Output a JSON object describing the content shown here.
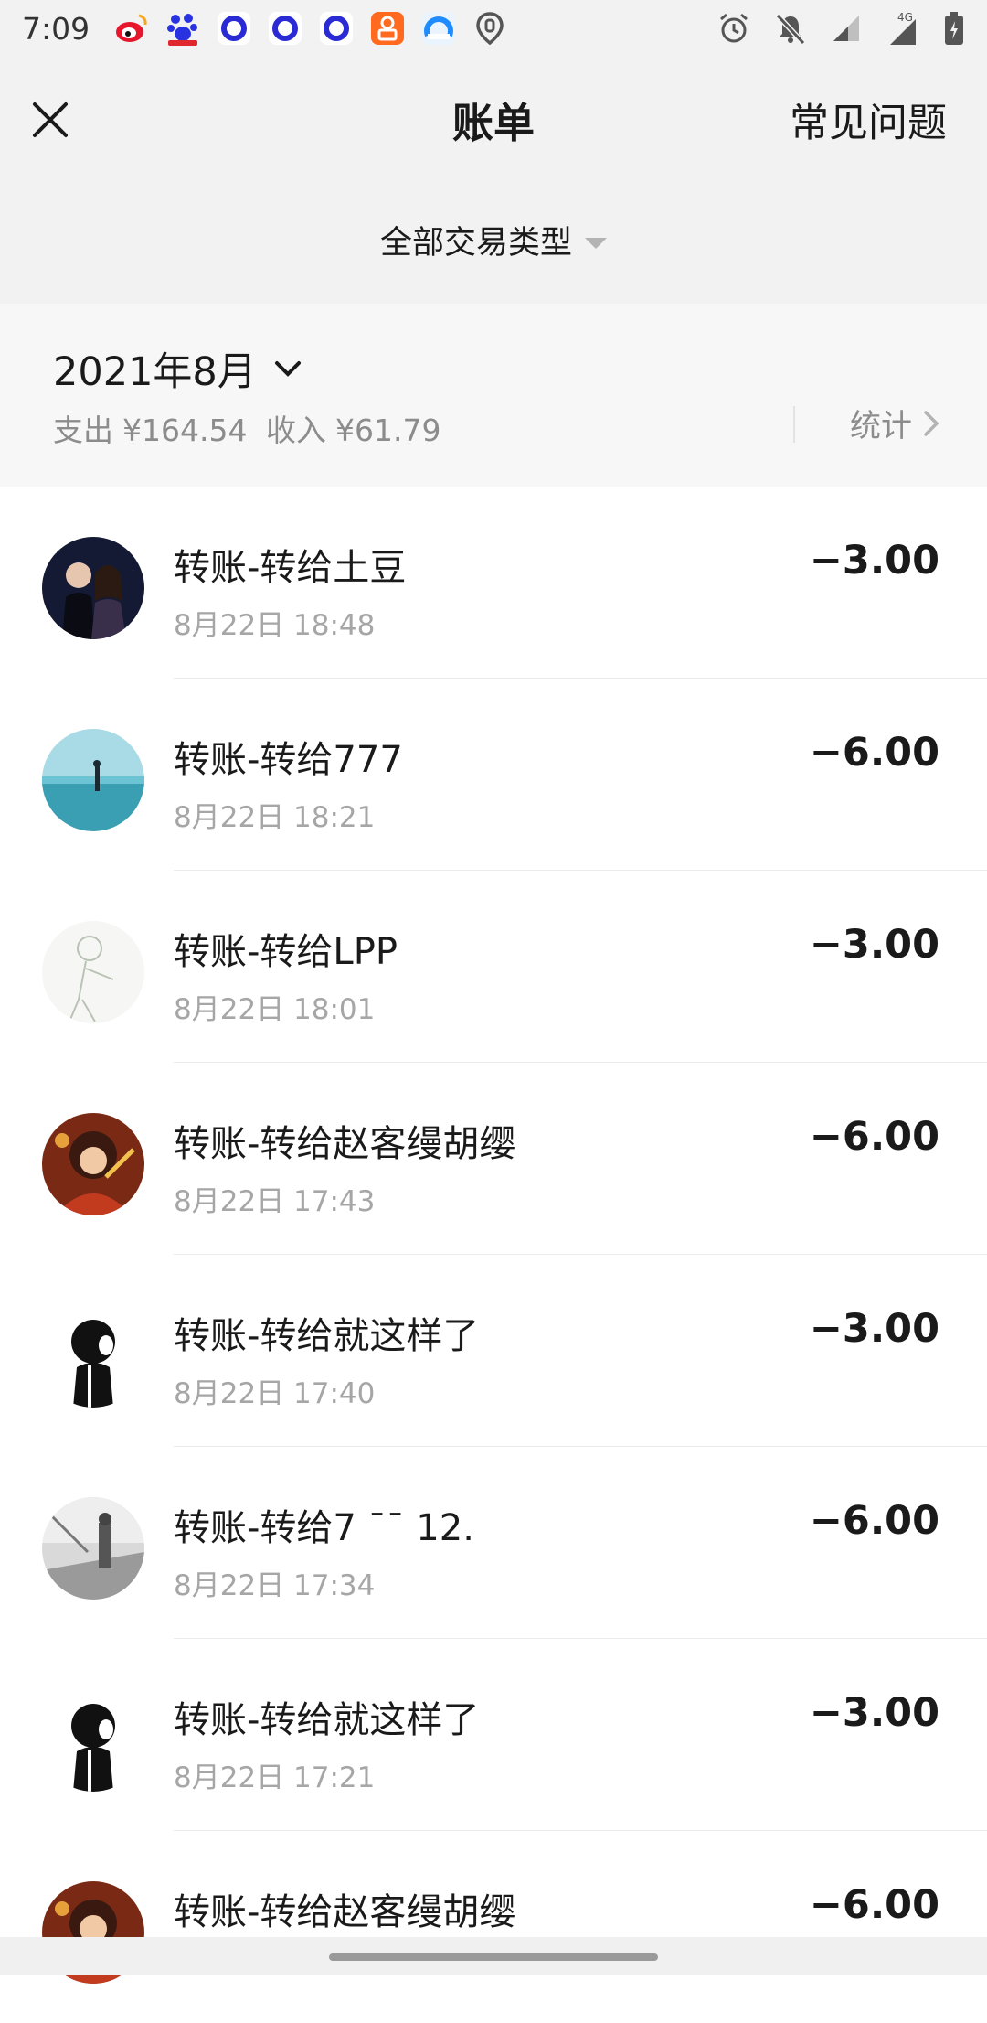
{
  "status_bar": {
    "time": "7:09",
    "apps": [
      "weibo-icon",
      "baidu-icon",
      "app-circle-icon",
      "app-circle-icon",
      "app-circle-icon",
      "taobao-icon",
      "browser-icon",
      "location-icon"
    ],
    "network": "4G"
  },
  "nav": {
    "title": "账单",
    "faq_label": "常见问题"
  },
  "filter": {
    "label": "全部交易类型"
  },
  "month": {
    "label": "2021年8月",
    "expense_label": "支出",
    "expense_value": "¥164.54",
    "income_label": "收入",
    "income_value": "¥61.79",
    "stats_label": "统计"
  },
  "transactions": [
    {
      "title": "转账-转给土豆",
      "time": "8月22日 18:48",
      "amount": "−3.00"
    },
    {
      "title": "转账-转给777",
      "time": "8月22日 18:21",
      "amount": "−6.00"
    },
    {
      "title": "转账-转给LPP",
      "time": "8月22日 18:01",
      "amount": "−3.00"
    },
    {
      "title": "转账-转给赵客缦胡缨",
      "time": "8月22日 17:43",
      "amount": "−6.00"
    },
    {
      "title": "转账-转给就这样了",
      "time": "8月22日 17:40",
      "amount": "−3.00"
    },
    {
      "title": "转账-转给7 ¯¯ 12.",
      "time": "8月22日 17:34",
      "amount": "−6.00"
    },
    {
      "title": "转账-转给就这样了",
      "time": "8月22日 17:21",
      "amount": "−3.00"
    },
    {
      "title": "转账-转给赵客缦胡缨",
      "time": "",
      "amount": "−6.00"
    }
  ],
  "colors": {
    "header_bg": "#f2f2f2",
    "summary_bg": "#f7f7f7",
    "secondary_text": "#8c8c8c",
    "primary_text": "#1a1a1a"
  }
}
